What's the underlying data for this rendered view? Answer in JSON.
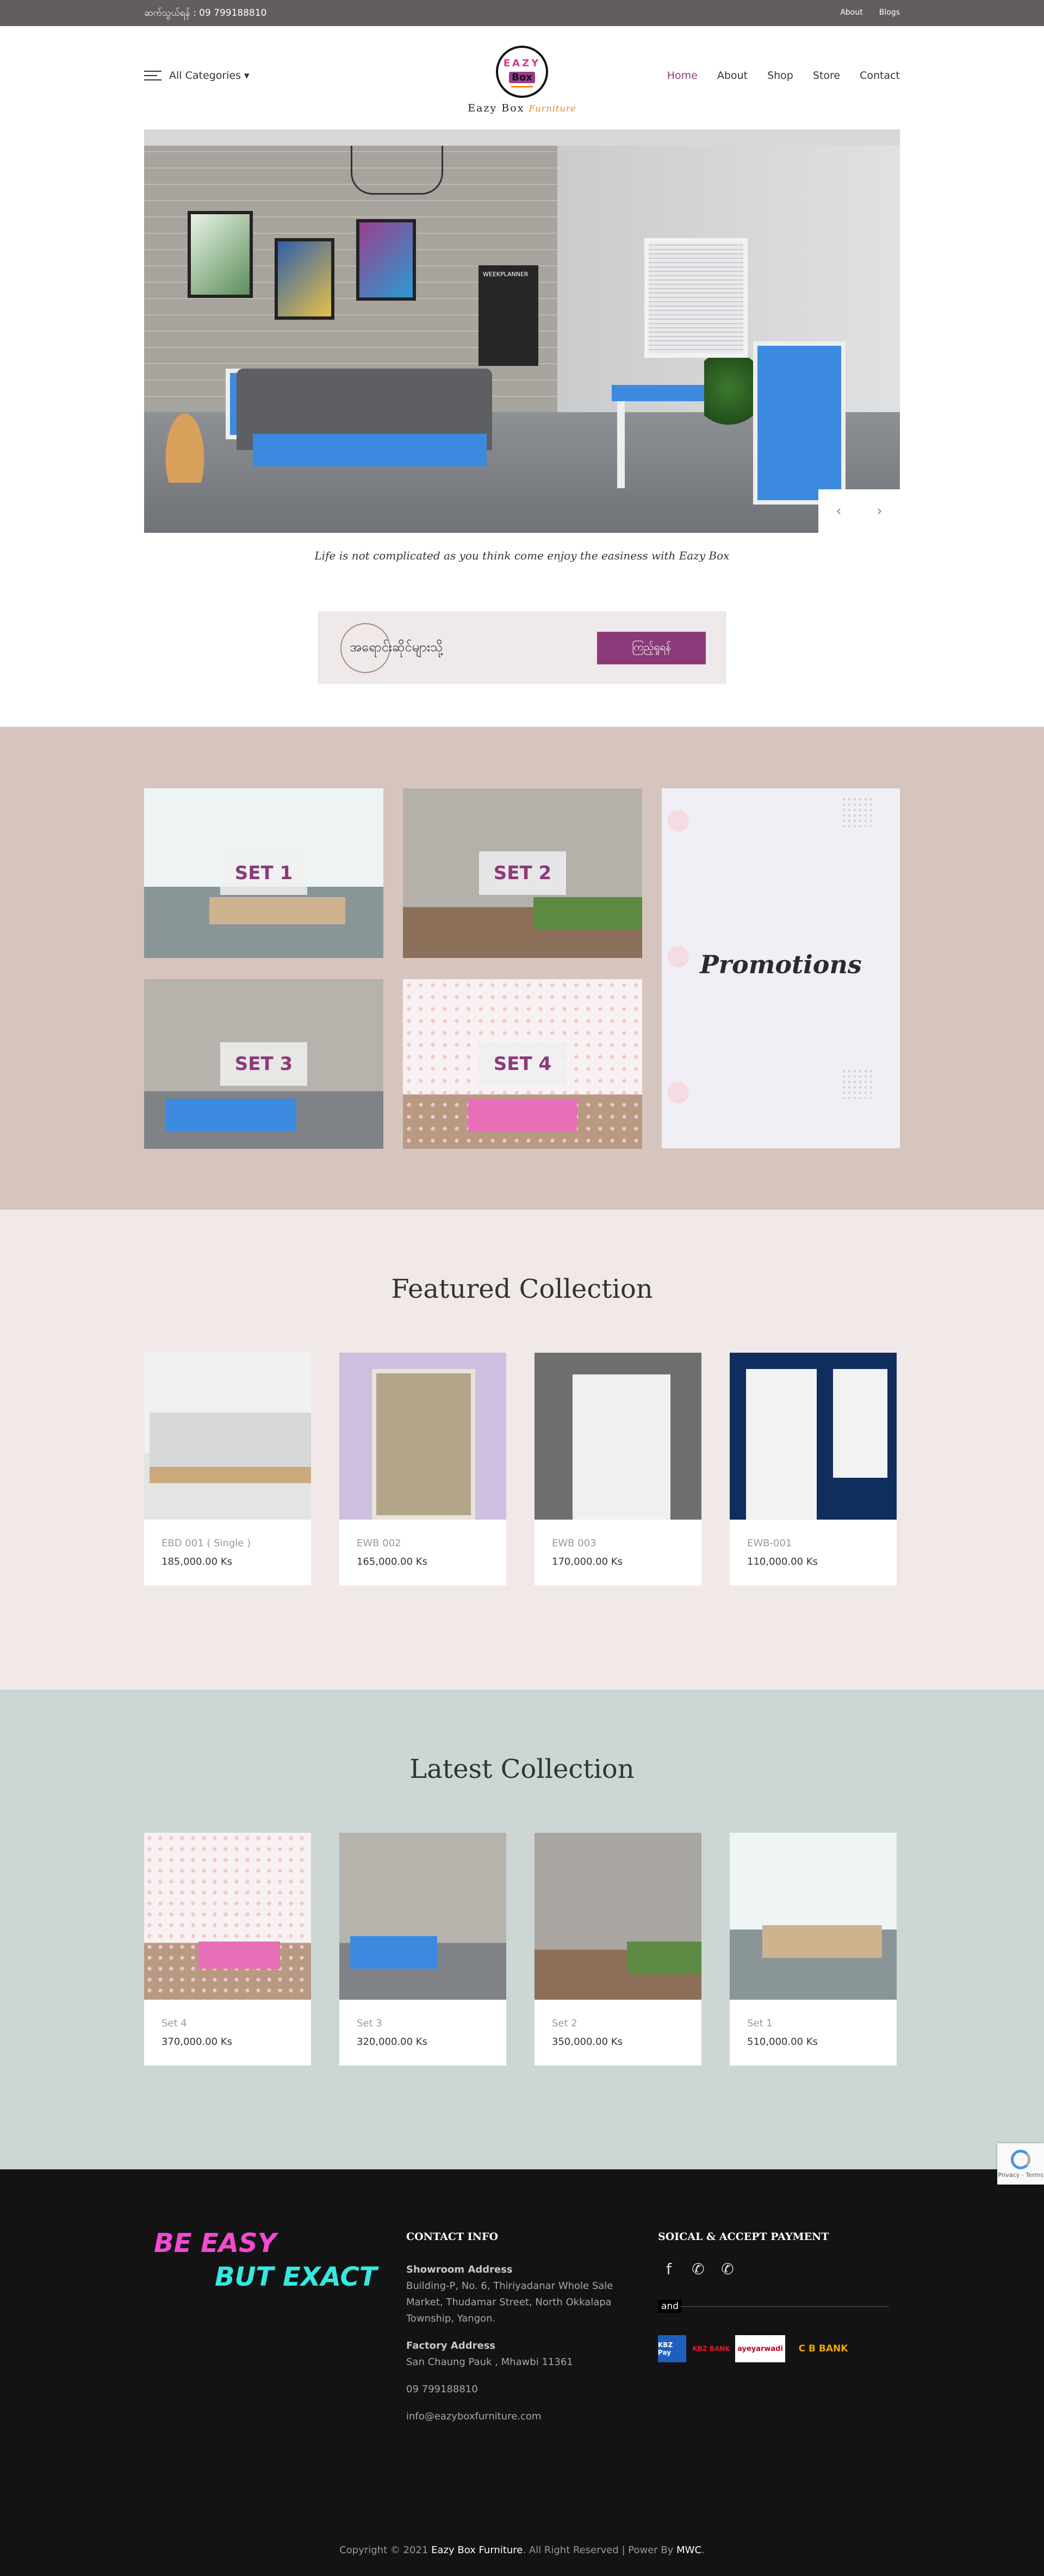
{
  "topbar": {
    "phone": "ဆက်သွယ်ရန် : 09 799188810",
    "about": "About",
    "blogs": "Blogs"
  },
  "header": {
    "categories": "All Categories ▾",
    "logo": {
      "line1": "EAZY",
      "line2": "Box",
      "name": "Eazy Box",
      "sub": "Furniture"
    },
    "nav": [
      "Home",
      "About",
      "Shop",
      "Store",
      "Contact"
    ]
  },
  "hero": {
    "prev": "‹",
    "next": "›",
    "tagline": "Life is not complicated as you think come enjoy the easiness with Eazy Box",
    "planner_title": "WEEKPLANNER"
  },
  "contact_box": {
    "text": "အရောင်းဆိုင်များသို့",
    "button": "ကြည့်ရှုရန်"
  },
  "sets": [
    "SET 1",
    "SET 2",
    "SET 3",
    "SET 4"
  ],
  "promotions": "Promotions",
  "featured": {
    "title": "Featured Collection",
    "items": [
      {
        "name": "EBD 001 ( Single )",
        "price": "185,000.00 Ks"
      },
      {
        "name": "EWB 002",
        "price": "165,000.00 Ks"
      },
      {
        "name": "EWB 003",
        "price": "170,000.00 Ks"
      },
      {
        "name": "EWB-001",
        "price": "110,000.00 Ks"
      }
    ]
  },
  "latest": {
    "title": "Latest Collection",
    "items": [
      {
        "name": "Set 4",
        "price": "370,000.00 Ks"
      },
      {
        "name": "Set 3",
        "price": "320,000.00 Ks"
      },
      {
        "name": "Set 2",
        "price": "350,000.00 Ks"
      },
      {
        "name": "Set 1",
        "price": "510,000.00 Ks"
      }
    ]
  },
  "footer": {
    "slogan_line1": "BE EASY",
    "slogan_line2": "BUT EXACT",
    "contact_heading": "CONTACT INFO",
    "showroom_label": "Showroom Address",
    "showroom_address": "Building-P, No. 6, Thiriyadanar Whole Sale Market, Thudamar Street, North Okkalapa Township, Yangon.",
    "factory_label": "Factory Address",
    "factory_address": "San Chaung Pauk , Mhawbi 11361",
    "phone": "09 799188810",
    "email": "info@eazyboxfurniture.com",
    "social_heading": "SOICAL & ACCEPT PAYMENT",
    "and": "and",
    "payments": [
      "KBZ Pay",
      "KBZ BANK",
      "ayeyarwadi",
      "C B BANK"
    ],
    "copyright_pre": "Copyright © 2021 ",
    "copyright_brand": "Eazy Box Furniture",
    "copyright_mid": ". All Right Reserved | Power By ",
    "copyright_power": "MWC",
    "copyright_end": "."
  },
  "recaptcha": "Privacy - Terms",
  "colors": {
    "accent": "#8b3a79",
    "topbar": "#615e5d",
    "sets_bg": "#d6c4be",
    "featured_bg": "#f1e9e8",
    "latest_bg": "#ccd7d5",
    "footer_bg": "#131313"
  }
}
